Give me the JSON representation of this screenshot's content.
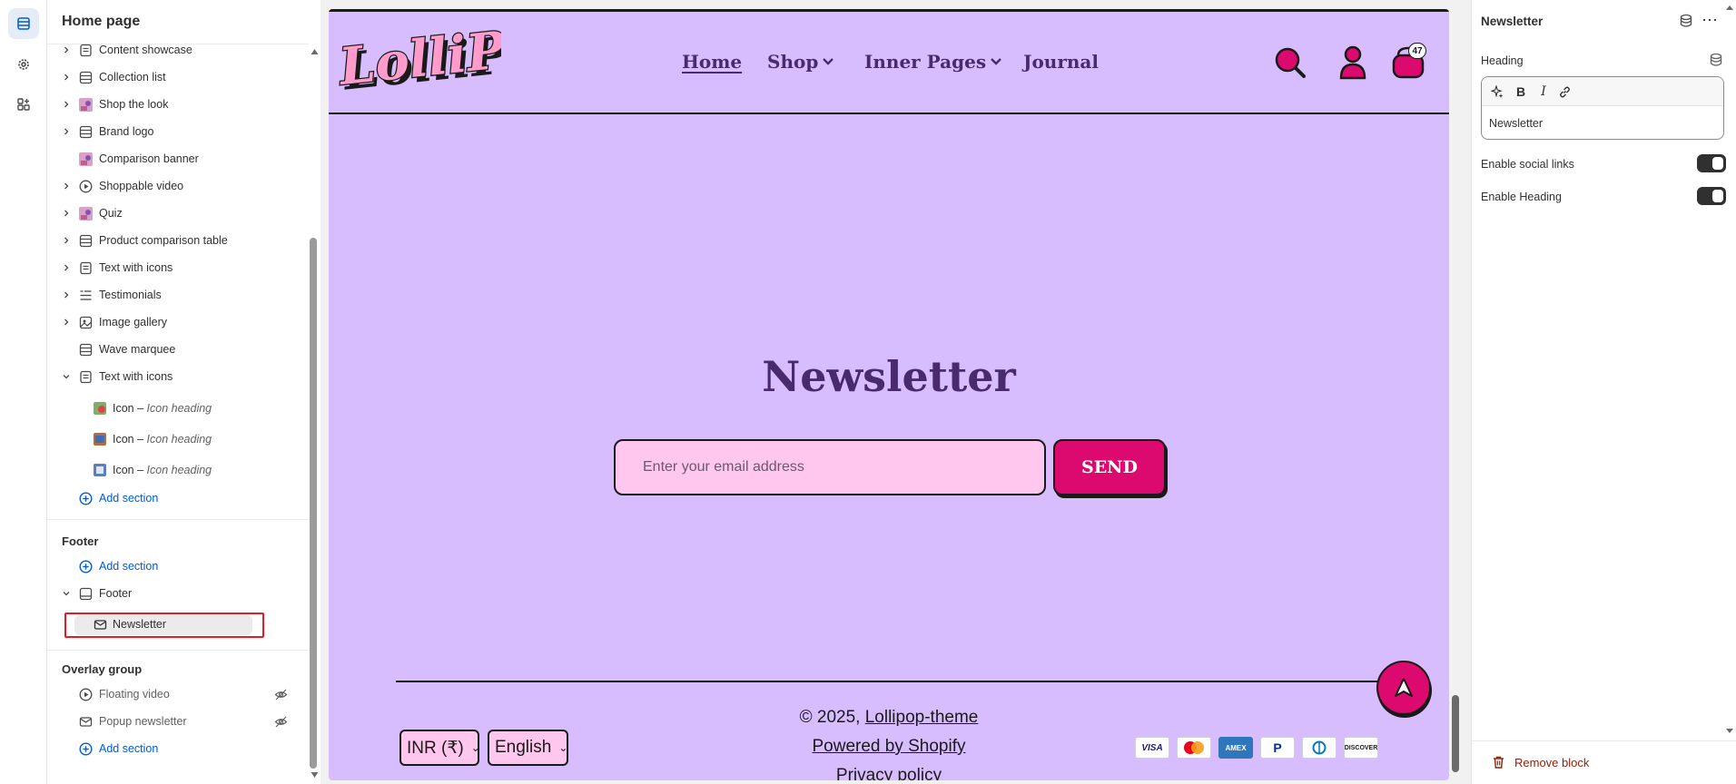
{
  "sidebar": {
    "title": "Home page",
    "sections": [
      {
        "label": "Content showcase",
        "icon": "section-icon",
        "chevron": "right"
      },
      {
        "label": "Collection list",
        "icon": "grid-icon",
        "chevron": "right"
      },
      {
        "label": "Shop the look",
        "icon": "image-thumb-icon",
        "chevron": "right"
      },
      {
        "label": "Brand logo",
        "icon": "grid-icon",
        "chevron": "right"
      },
      {
        "label": "Comparison banner",
        "icon": "image-thumb-icon",
        "chevron": ""
      },
      {
        "label": "Shoppable video",
        "icon": "play-icon",
        "chevron": "right"
      },
      {
        "label": "Quiz",
        "icon": "image-thumb-icon",
        "chevron": "right"
      },
      {
        "label": "Product comparison table",
        "icon": "grid-icon",
        "chevron": "right"
      },
      {
        "label": "Text with icons",
        "icon": "section-icon",
        "chevron": "right"
      },
      {
        "label": "Testimonials",
        "icon": "list-icon",
        "chevron": "right"
      },
      {
        "label": "Image gallery",
        "icon": "gallery-icon",
        "chevron": "right"
      },
      {
        "label": "Wave marquee",
        "icon": "grid-icon",
        "chevron": ""
      },
      {
        "label": "Text with icons",
        "icon": "section-icon",
        "chevron": "down"
      }
    ],
    "sub_blocks": [
      {
        "label": "Icon – ",
        "italic": "Icon heading"
      },
      {
        "label": "Icon – ",
        "italic": "Icon heading"
      },
      {
        "label": "Icon – ",
        "italic": "Icon heading"
      }
    ],
    "add_section": "Add section",
    "footer_group": {
      "title": "Footer",
      "add_section": "Add section",
      "footer_label": "Footer",
      "selected_block": "Newsletter"
    },
    "overlay_group": {
      "title": "Overlay group",
      "items": [
        {
          "label": "Floating video",
          "icon": "play-icon"
        },
        {
          "label": "Popup newsletter",
          "icon": "mail-icon"
        }
      ],
      "add_section": "Add section"
    }
  },
  "preview": {
    "logo_text": "LolliPop",
    "nav": [
      {
        "label": "Home",
        "dropdown": false
      },
      {
        "label": "Shop",
        "dropdown": true
      },
      {
        "label": "Inner Pages",
        "dropdown": true
      },
      {
        "label": "Journal",
        "dropdown": false
      }
    ],
    "cart_count": "47",
    "newsletter": {
      "heading": "Newsletter",
      "placeholder": "Enter your email address",
      "button": "SEND"
    },
    "footer": {
      "copyright_prefix": "© 2025, ",
      "copyright_link": "Lollipop-theme",
      "powered": "Powered by Shopify",
      "privacy": "Privacy policy",
      "currency": "INR (₹)",
      "language": "English",
      "payments": [
        "VISA",
        "MC",
        "AMEX",
        "PayPal",
        "Diners",
        "DISCOVER"
      ]
    },
    "colors": {
      "background": "#d8bdfe",
      "accent": "#dc0a6e",
      "input": "#ffc6ee",
      "heading": "#4a2a6e"
    }
  },
  "panel": {
    "title": "Newsletter",
    "heading_label": "Heading",
    "heading_value": "Newsletter",
    "toggles": [
      {
        "label": "Enable social links",
        "on": true
      },
      {
        "label": "Enable Heading",
        "on": true
      }
    ],
    "remove_block": "Remove block"
  }
}
